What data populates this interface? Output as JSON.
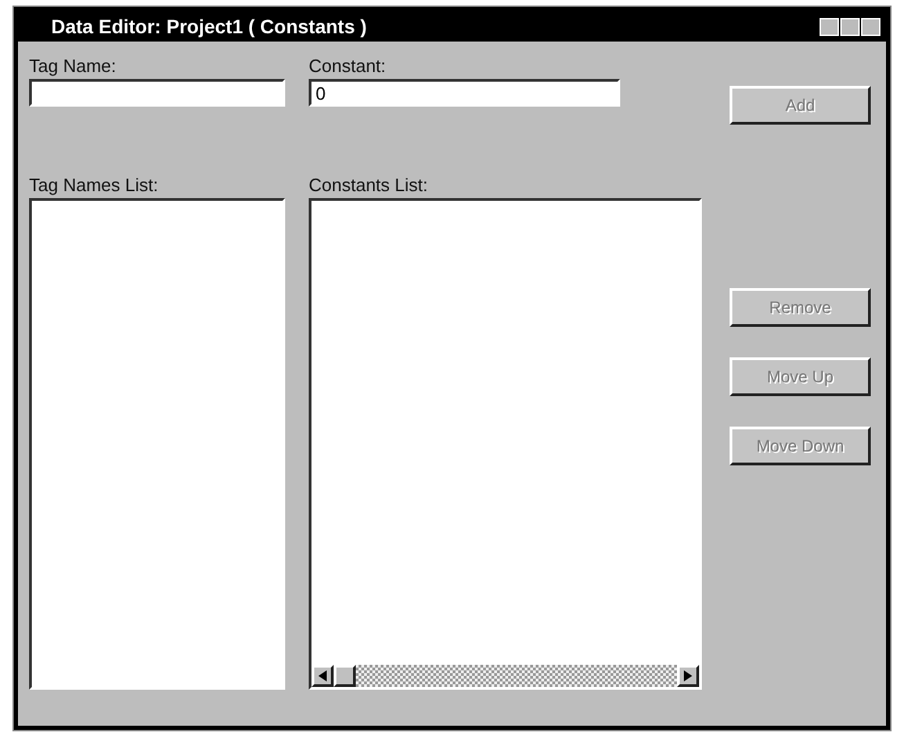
{
  "window": {
    "title": "Data Editor: Project1 ( Constants )"
  },
  "fields": [
    {
      "label": "Tag Name:"
    },
    {
      "label": "Constant:",
      "value": "0"
    }
  ],
  "lists": [
    {
      "label": "Tag Names List:",
      "scrollbar": false
    },
    {
      "label": "Constants List:",
      "scrollbar": true
    }
  ],
  "buttons": [
    {
      "label": "Add",
      "disabled": true
    },
    {
      "label": "Remove",
      "disabled": true
    },
    {
      "label": "Move Up",
      "disabled": true
    },
    {
      "label": "Move Down",
      "disabled": true
    }
  ]
}
